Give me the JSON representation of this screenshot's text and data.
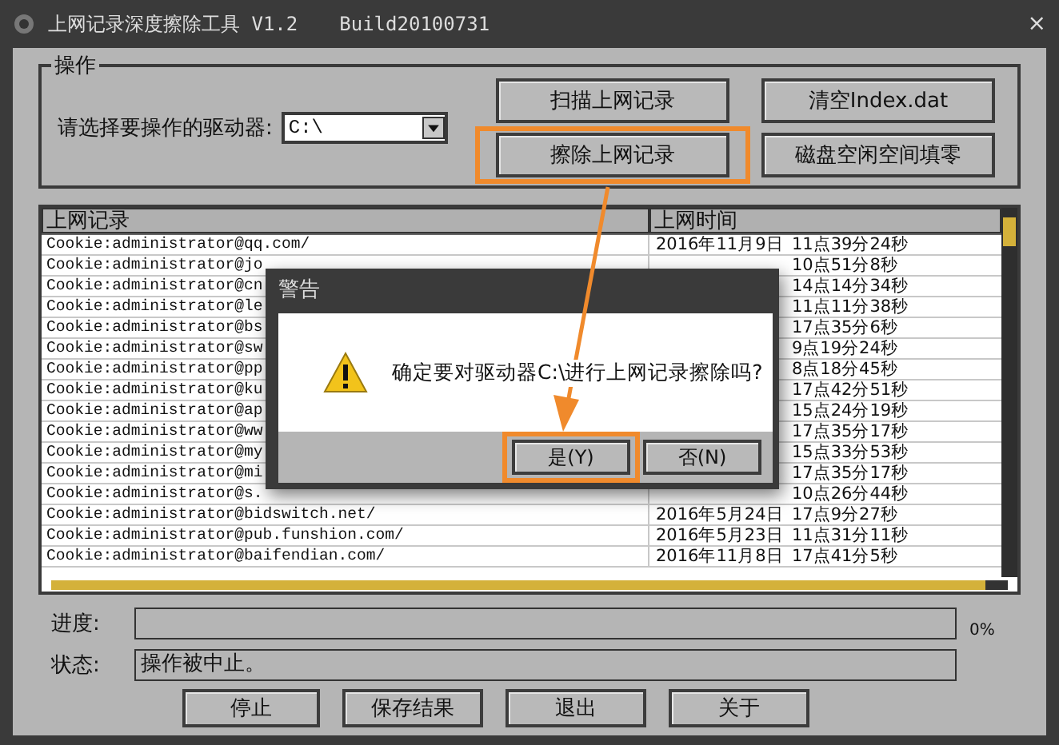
{
  "window": {
    "title": "上网记录深度擦除工具 V1.2",
    "build": "Build20100731",
    "close": "×"
  },
  "operations": {
    "title": "操作",
    "drive_label": "请选择要操作的驱动器:",
    "drive_value": "C:\\",
    "buttons": [
      {
        "label": "扫描上网记录",
        "highlighted": false
      },
      {
        "label": "清空Index.dat",
        "highlighted": false
      },
      {
        "label": "擦除上网记录",
        "highlighted": true
      },
      {
        "label": "磁盘空闲空间填零",
        "highlighted": false
      }
    ]
  },
  "table": {
    "columns": [
      "上网记录",
      "上网时间"
    ],
    "rows": [
      {
        "record": "Cookie:administrator@qq.com/",
        "date": "2016年11月9日",
        "time": "11点39分24秒"
      },
      {
        "record": "Cookie:administrator@jo",
        "time": "10点51分8秒"
      },
      {
        "record": "Cookie:administrator@cn",
        "time": "14点14分34秒"
      },
      {
        "record": "Cookie:administrator@le",
        "time": "11点11分38秒"
      },
      {
        "record": "Cookie:administrator@bs",
        "time": "17点35分6秒"
      },
      {
        "record": "Cookie:administrator@sw",
        "time": "9点19分24秒"
      },
      {
        "record": "Cookie:administrator@pp",
        "time": "8点18分45秒"
      },
      {
        "record": "Cookie:administrator@ku",
        "time": "17点42分51秒"
      },
      {
        "record": "Cookie:administrator@ap",
        "time": "15点24分19秒"
      },
      {
        "record": "Cookie:administrator@ww",
        "time": "17点35分17秒"
      },
      {
        "record": "Cookie:administrator@my",
        "time": "15点33分53秒"
      },
      {
        "record": "Cookie:administrator@mi",
        "time": "17点35分17秒"
      },
      {
        "record": "Cookie:administrator@s.",
        "time": "10点26分44秒"
      },
      {
        "record": "Cookie:administrator@bidswitch.net/",
        "date": "2016年5月24日",
        "time": "17点9分27秒"
      },
      {
        "record": "Cookie:administrator@pub.funshion.com/",
        "date": "2016年5月23日",
        "time": "11点31分11秒"
      },
      {
        "record": "Cookie:administrator@baifendian.com/",
        "date": "2016年11月8日",
        "time": "17点41分5秒"
      }
    ]
  },
  "progress": {
    "label": "进度:",
    "level": 0,
    "reading": "0%"
  },
  "status": {
    "label": "状态:",
    "value": "操作被中止。"
  },
  "buttons": [
    {
      "label": "停止"
    },
    {
      "label": "保存结果"
    },
    {
      "label": "退出"
    },
    {
      "label": "关于"
    }
  ],
  "dialog": {
    "title": "警告",
    "message": "确定要对驱动器C:\\进行上网记录擦除吗?",
    "buttons": [
      {
        "label": "是(Y)",
        "highlighted": true
      },
      {
        "label": "否(N)",
        "highlighted": false
      }
    ]
  }
}
